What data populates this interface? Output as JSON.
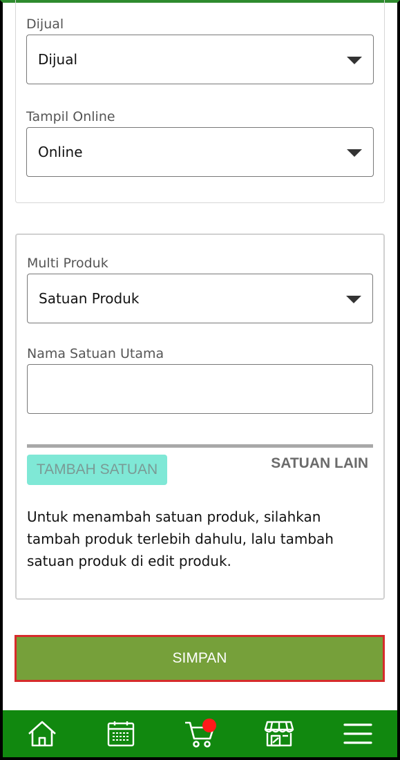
{
  "status": {
    "label": "Dijual",
    "value": "Dijual"
  },
  "online": {
    "label": "Tampil Online",
    "value": "Online"
  },
  "multi": {
    "label": "Multi Produk",
    "value": "Satuan Produk"
  },
  "unit_name": {
    "label": "Nama Satuan Utama",
    "value": ""
  },
  "units": {
    "add_button": "TAMBAH SATUAN",
    "other_tab": "SATUAN LAIN",
    "info": "Untuk menambah satuan produk, silahkan tambah produk terlebih dahulu, lalu tambah satuan produk di edit produk."
  },
  "save_label": "SIMPAN",
  "nav": {
    "items": [
      "home-icon",
      "calendar-icon",
      "cart-icon",
      "store-icon",
      "menu-icon"
    ],
    "cart_badge_color": "#ff1a1a",
    "bar_color": "#11880f"
  }
}
